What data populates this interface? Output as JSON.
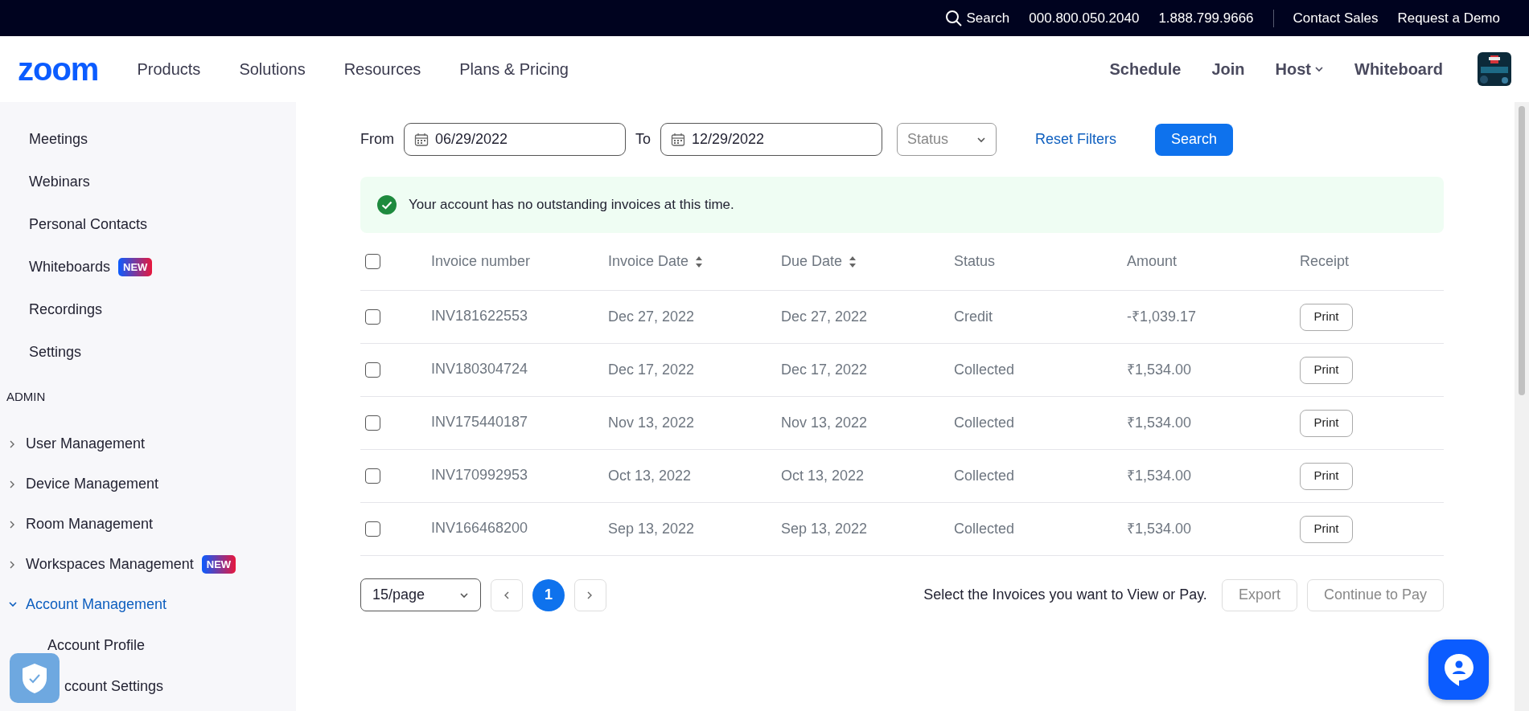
{
  "top_bar": {
    "search": "Search",
    "phones": [
      "000.800.050.2040",
      "1.888.799.9666"
    ],
    "links": [
      "Contact Sales",
      "Request a Demo"
    ]
  },
  "nav": {
    "logo": "zoom",
    "menu": [
      "Products",
      "Solutions",
      "Resources",
      "Plans & Pricing"
    ],
    "right": [
      {
        "label": "Schedule",
        "dropdown": false
      },
      {
        "label": "Join",
        "dropdown": false
      },
      {
        "label": "Host",
        "dropdown": true
      },
      {
        "label": "Whiteboard",
        "dropdown": false
      }
    ],
    "avatar": {
      "kind": "picture"
    }
  },
  "sidebar": {
    "items": [
      {
        "label": "Meetings"
      },
      {
        "label": "Webinars"
      },
      {
        "label": "Personal Contacts"
      },
      {
        "label": "Whiteboards",
        "badge": "NEW"
      },
      {
        "label": "Recordings"
      },
      {
        "label": "Settings"
      }
    ],
    "section": "ADMIN",
    "admin_items": [
      {
        "label": "User Management",
        "expanded": false
      },
      {
        "label": "Device Management",
        "expanded": false
      },
      {
        "label": "Room Management",
        "expanded": false
      },
      {
        "label": "Workspaces Management",
        "expanded": false,
        "badge": "NEW"
      },
      {
        "label": "Account Management",
        "expanded": true,
        "children": [
          {
            "label": "Account Profile"
          },
          {
            "label": "ccount Settings"
          }
        ]
      }
    ]
  },
  "filters": {
    "from_label": "From",
    "from": "06/29/2022",
    "to_label": "To",
    "to": "12/29/2022",
    "status_placeholder": "Status",
    "reset": "Reset Filters",
    "search": "Search"
  },
  "alert": "Your account has no outstanding invoices at this time.",
  "table": {
    "columns": [
      {
        "label": "Invoice number",
        "sortable": false
      },
      {
        "label": "Invoice Date",
        "sortable": true
      },
      {
        "label": "Due Date",
        "sortable": true
      },
      {
        "label": "Status",
        "sortable": false
      },
      {
        "label": "Amount",
        "sortable": false
      },
      {
        "label": "Receipt",
        "sortable": false
      }
    ],
    "header_checked": false,
    "rows": [
      {
        "checked": false,
        "cells": [
          "INV181622553",
          "Dec 27, 2022",
          "Dec 27, 2022",
          "Credit",
          "-₹1,039.17"
        ],
        "action": "Print"
      },
      {
        "checked": false,
        "cells": [
          "INV180304724",
          "Dec 17, 2022",
          "Dec 17, 2022",
          "Collected",
          "₹1,534.00"
        ],
        "action": "Print"
      },
      {
        "checked": false,
        "cells": [
          "INV175440187",
          "Nov 13, 2022",
          "Nov 13, 2022",
          "Collected",
          "₹1,534.00"
        ],
        "action": "Print"
      },
      {
        "checked": false,
        "cells": [
          "INV170992953",
          "Oct 13, 2022",
          "Oct 13, 2022",
          "Collected",
          "₹1,534.00"
        ],
        "action": "Print"
      },
      {
        "checked": false,
        "cells": [
          "INV166468200",
          "Sep 13, 2022",
          "Sep 13, 2022",
          "Collected",
          "₹1,534.00"
        ],
        "action": "Print"
      }
    ]
  },
  "footer": {
    "page_size": "15/page",
    "pages": [
      {
        "label": "1",
        "selected": true
      }
    ],
    "hint": "Select the Invoices you want to View or Pay.",
    "buttons": [
      {
        "label": "Export",
        "disabled": true
      },
      {
        "label": "Continue to Pay",
        "disabled": true
      }
    ]
  }
}
